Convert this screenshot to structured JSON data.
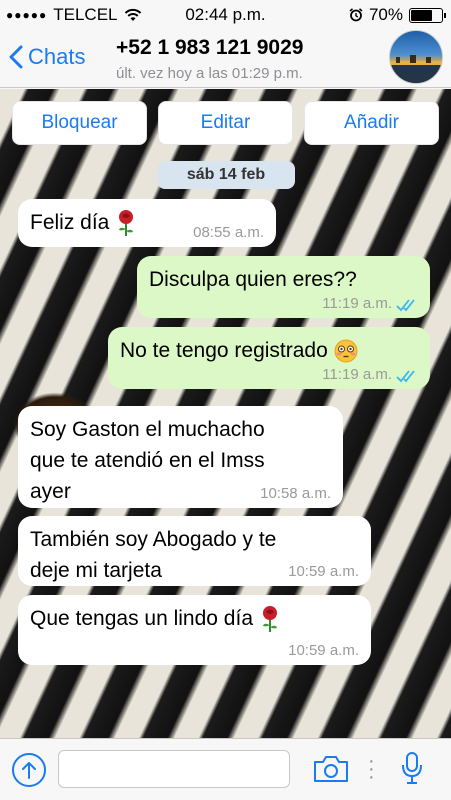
{
  "status_bar": {
    "signal_dots": "●●●●●",
    "carrier": "TELCEL",
    "time": "02:44 p.m.",
    "battery_level": "70%"
  },
  "nav": {
    "back_label": "Chats",
    "contact_name": "+52 1 983 121 9029",
    "last_seen": "últ. vez hoy a las 01:29 p.m."
  },
  "actions": {
    "block": "Bloquear",
    "edit": "Editar",
    "add": "Añadir"
  },
  "date_label": "sáb 14 feb",
  "messages": [
    {
      "direction": "in",
      "text": "Feliz día",
      "emoji": "rose",
      "time": "08:55 a.m."
    },
    {
      "direction": "out",
      "text": "Disculpa quien eres??",
      "time": "11:19 a.m.",
      "status": "read"
    },
    {
      "direction": "out",
      "text": "No te tengo registrado",
      "emoji": "flushed-face",
      "time": "11:19 a.m.",
      "status": "read"
    },
    {
      "direction": "in",
      "text_lines": [
        "Soy Gaston el muchacho",
        "que te atendió en el Imss",
        "ayer"
      ],
      "time": "10:58 a.m."
    },
    {
      "direction": "in",
      "text_lines": [
        "También soy Abogado y te",
        "deje mi tarjeta"
      ],
      "time": "10:59 a.m."
    },
    {
      "direction": "in",
      "text": "Que tengas un lindo día",
      "emoji": "rose",
      "time": "10:59 a.m."
    }
  ],
  "input": {
    "placeholder": ""
  },
  "colors": {
    "accent": "#1a7bf2",
    "outgoing_bubble": "#dcf8c6",
    "incoming_bubble": "#ffffff",
    "read_ticks": "#34b7f1"
  }
}
